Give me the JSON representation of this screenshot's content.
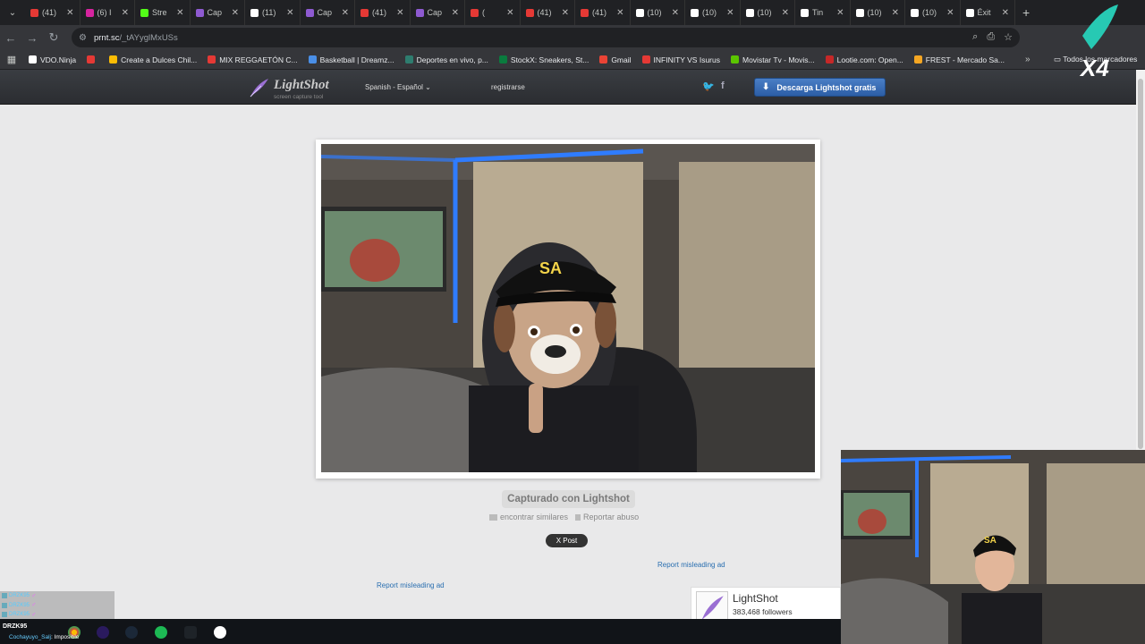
{
  "browser": {
    "tabs": [
      {
        "title": "(41)",
        "color": "#e53935"
      },
      {
        "title": "(6) I",
        "color": "#d6249f"
      },
      {
        "title": "Stre",
        "color": "#53fc18"
      },
      {
        "title": "Cap",
        "color": "#8e5ad1"
      },
      {
        "title": "(11)",
        "color": "#ffffff"
      },
      {
        "title": "Cap",
        "color": "#8e5ad1"
      },
      {
        "title": "(41)",
        "color": "#e53935"
      },
      {
        "title": "Cap",
        "color": "#8e5ad1"
      },
      {
        "title": "(",
        "color": "#e53935"
      },
      {
        "title": "(41)",
        "color": "#e53935"
      },
      {
        "title": "(41)",
        "color": "#e53935"
      },
      {
        "title": "(10)",
        "color": "#ffffff"
      },
      {
        "title": "(10)",
        "color": "#ffffff"
      },
      {
        "title": "(10)",
        "color": "#ffffff"
      },
      {
        "title": "Tin",
        "color": "#ffffff"
      },
      {
        "title": "(10)",
        "color": "#ffffff"
      },
      {
        "title": "(10)",
        "color": "#ffffff"
      },
      {
        "title": "Éxit",
        "color": "#ffffff"
      }
    ],
    "url_host": "prnt.sc",
    "url_path": "/_tAYyglMxUSs",
    "bookmarks": [
      {
        "label": "VDO.Ninja",
        "color": "#ffffff"
      },
      {
        "label": "",
        "color": "#e53935"
      },
      {
        "label": "Create a Dulces Chil...",
        "color": "#fbbc04"
      },
      {
        "label": "MIX REGGAETÓN C...",
        "color": "#e53935"
      },
      {
        "label": "Basketball | Dreamz...",
        "color": "#4a8fe7"
      },
      {
        "label": "Deportes en vivo, p...",
        "color": "#2e7d6f"
      },
      {
        "label": "StockX: Sneakers, St...",
        "color": "#0a7b3e"
      },
      {
        "label": "Gmail",
        "color": "#ea4335"
      },
      {
        "label": "INFINITY VS Isurus",
        "color": "#e53935"
      },
      {
        "label": "Movistar Tv - Movis...",
        "color": "#5bc500"
      },
      {
        "label": "Lootie.com: Open...",
        "color": "#c62828"
      },
      {
        "label": "FREST - Mercado Sa...",
        "color": "#f5a623"
      }
    ],
    "bookmark_folder": "Todos los marcadores"
  },
  "lightshot": {
    "logo_name": "LightShot",
    "logo_tagline": "screen capture tool",
    "language": "Spanish - Español",
    "register": "registrarse",
    "download_label": "Descarga Lightshot gratis",
    "captured_label": "Capturado con Lightshot",
    "find_similar": "encontrar similares",
    "report_abuse": "Reportar abuso",
    "x_post": "X  Post",
    "misleading_ad_1": "Report misleading ad",
    "misleading_ad_2": "Report misleading ad",
    "fb_name": "LightShot",
    "fb_followers": "383,468 followers"
  },
  "overlay": {
    "x4_label": "X4",
    "chat_user": "DRZK95",
    "chat_line_user": "Cochayuyo_Salj",
    "chat_line_text": ": Imposible"
  }
}
